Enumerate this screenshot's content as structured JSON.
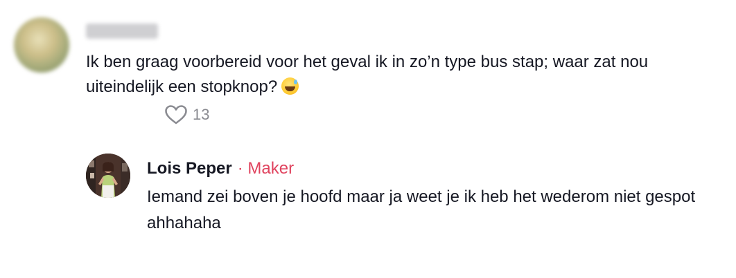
{
  "comment": {
    "username": "",
    "text": "Ik ben graag voorbereid voor het geval ik in zo’n type bus stap; waar zat nou uiteindelijk een stopknop?",
    "emoji": "sweat-smile-emoji",
    "likes": "13"
  },
  "reply": {
    "author": "Lois Peper",
    "badge": "· Maker",
    "text": "Iemand zei boven je hoofd maar ja weet je ik heb het wederom niet gespot ahhahaha"
  },
  "icons": {
    "like": "heart-outline-icon"
  },
  "colors": {
    "text": "#161823",
    "muted": "#8a8b91",
    "maker": "#e0435e"
  }
}
